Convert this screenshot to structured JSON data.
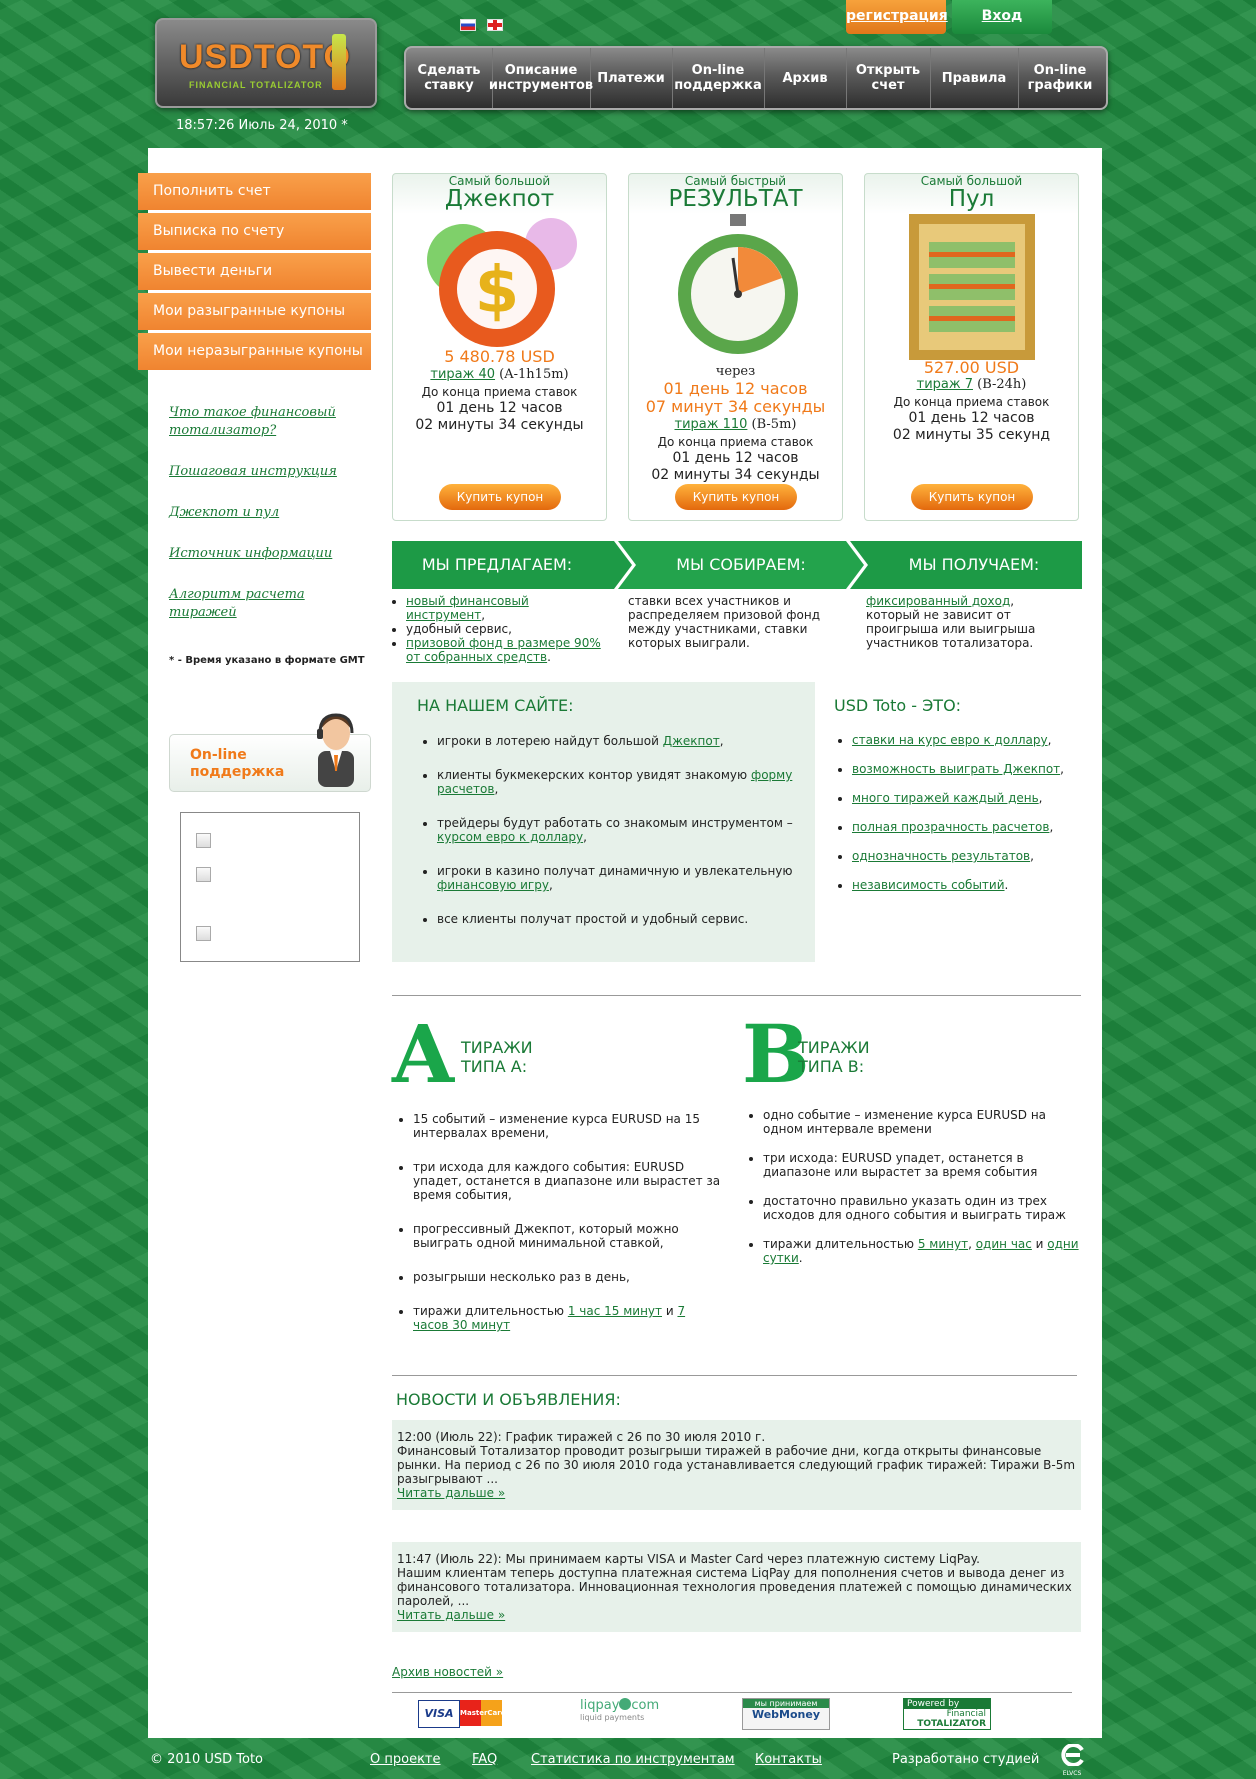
{
  "header": {
    "logo_main": "USDTOTO",
    "logo_sub": "FINANCIAL TOTALIZATOR",
    "clock": "18:57:26 Июль 24, 2010 *",
    "register": "регистрация",
    "login": "Вход",
    "nav": [
      {
        "label": "Сделать\nставку"
      },
      {
        "label": "Описание\nинструментов"
      },
      {
        "label": "Платежи"
      },
      {
        "label": "On-line\nподдержка"
      },
      {
        "label": "Архив"
      },
      {
        "label": "Открыть\nсчет"
      },
      {
        "label": "Правила"
      },
      {
        "label": "On-line\nграфики"
      }
    ]
  },
  "sidebar": {
    "menu": [
      "Пополнить счет",
      "Выписка по счету",
      "Вывести деньги",
      "Мои разыгранные купоны",
      "Мои неразыгранные купоны"
    ],
    "links": [
      "Что такое финансовый тотализатор?",
      "Пошаговая инструкция",
      "Джекпот и пул",
      "Источник информации",
      "Алгоритм расчета тиражей"
    ],
    "gmt_note": "* - Время указано в формате GMT",
    "support": "On-line\nподдержка"
  },
  "promos": [
    {
      "sub": "Самый большой",
      "title": "Джекпот",
      "amount": "5 480.78 USD",
      "draw_link": "тираж 40",
      "draw_code": "(A-1h15m)",
      "until": "До конца приема ставок",
      "days": "01 день 12 часов",
      "minutes": "02 минуты 34 секунды",
      "buy": "Купить купон"
    },
    {
      "sub": "Самый быстрый",
      "title": "РЕЗУЛЬТАТ",
      "through": "через",
      "days_o": "01 день 12 часов",
      "min_o": "07 минут 34 секунды",
      "draw_link": "тираж 110",
      "draw_code": "(B-5m)",
      "until": "До конца приема ставок",
      "days": "01 день 12 часов",
      "minutes": "02 минуты 34 секунды",
      "buy": "Купить купон"
    },
    {
      "sub": "Самый большой",
      "title": "Пул",
      "amount": "527.00 USD",
      "draw_link": "тираж 7",
      "draw_code": "(B-24h)",
      "until": "До конца приема ставок",
      "days": "01 день 12 часов",
      "minutes": "02 минуты 35 секунд",
      "buy": "Купить купон"
    }
  ],
  "strip": {
    "a": "МЫ ПРЕДЛАГАЕМ:",
    "b": "МЫ СОБИРАЕМ:",
    "c": "МЫ ПОЛУЧАЕМ:"
  },
  "offer": {
    "l1_link": "новый финансовый инструмент",
    "l1_rest": ",",
    "l2": "удобный сервис,",
    "l3_link": "призовой фонд в размере 90% от собранных средств",
    "l3_rest": ".",
    "collect": "ставки всех участников и распределяем призовой фонд между участниками, ставки которых выиграли.",
    "get_link": "фиксированный доход",
    "get_rest": ", который не зависит от проигрыша или выигрыша участников тотализатора."
  },
  "site": {
    "title": "НА НАШЕМ САЙТЕ:",
    "i1": "игроки в лотерею найдут большой ",
    "i1_link": "Джекпот",
    "i1_end": ",",
    "i2": "клиенты букмекерских контор увидят знакомую ",
    "i2_link": "форму расчетов",
    "i2_end": ",",
    "i3": "трейдеры будут работать со знакомым инструментом – ",
    "i3_link": "курсом евро к доллару",
    "i3_end": ",",
    "i4": "игроки в казино получат динамичную и увлекательную ",
    "i4_link": "финансовую игру",
    "i4_end": ",",
    "i5": "все клиенты получат простой и удобный сервис."
  },
  "toto": {
    "title": "USD Toto - ЭТО:",
    "items": [
      "ставки на курс евро к доллару",
      "возможность выиграть Джекпот",
      "много тиражей каждый день",
      "полная прозрачность расчетов",
      "однозначность результатов",
      "независимость событий"
    ],
    "ends": [
      ",",
      ",",
      ",",
      ",",
      ",",
      "."
    ]
  },
  "typeA": {
    "letter": "A",
    "h1": "ТИРАЖИ",
    "h2": "ТИПА А:",
    "i1": "15 событий – изменение курса EURUSD на 15 интервалах времени,",
    "i2": "три исхода для каждого события: EURUSD упадет, останется в диапазоне или вырастет за время события,",
    "i3": "прогрессивный Джекпот, который можно выиграть одной минимальной ставкой,",
    "i4": "розыгрыши несколько раз в день,",
    "i5": "тиражи длительностью ",
    "i5_l1": "1 час 15 минут",
    "i5_and": " и ",
    "i5_l2": "7 часов 30 минут"
  },
  "typeB": {
    "letter": "B",
    "h1": "ТИРАЖИ",
    "h2": "ТИПА B:",
    "i1": "одно событие – изменение курса EURUSD на одном интервале времени",
    "i2": "три исхода: EURUSD упадет, останется в диапазоне или вырастет за время события",
    "i3": "достаточно правильно указать один из трех исходов для одного события и выиграть тираж",
    "i4": "тиражи длительностью ",
    "i4_l1": "5 минут",
    "i4_c": ", ",
    "i4_l2": "один час",
    "i4_and": " и ",
    "i4_l3": "одни сутки",
    "i4_end": "."
  },
  "news": {
    "title": "НОВОСТИ И ОБЪЯВЛЕНИЯ:",
    "items": [
      {
        "head": "12:00 (Июль 22): График тиражей с 26 по 30 июля 2010 г.",
        "body": "Финансовый Тотализатор проводит розыгрыши тиражей в рабочие дни, когда открыты финансовые рынки. На период с 26 по 30 июля 2010 года устанавливается следующий график тиражей: Тиражи B-5m разыгрывают ...",
        "more": "Читать дальше »"
      },
      {
        "head": "11:47 (Июль 22): Мы принимаем карты VISA и Master Card через платежную систему LiqPay.",
        "body": "Нашим клиентам теперь доступна платежная система LiqPay для пополнения счетов и вывода денег из финансового тотализатора. Инновационная технология проведения платежей с помощью динамических паролей, ...",
        "more": "Читать дальше »"
      }
    ],
    "archive": "Архив новостей »"
  },
  "payments": {
    "visa": "VISA",
    "mc": "MasterCard",
    "liqpay": "liqpay",
    "liqpay_com": "com",
    "liqpay_sub": "liquid payments",
    "webm_top": "мы принимаем",
    "webm": "WebMoney",
    "ft_top": "Powered by",
    "ft1": "Financial",
    "ft2": "TOTALIZATOR"
  },
  "footer": {
    "copy": "© 2010 USD Toto",
    "about": "О проекте",
    "faq": "FAQ",
    "stats": "Статистика по инструментам",
    "contacts": "Контакты",
    "dev": "Разработано студией",
    "dev_logo": "ELVCS"
  }
}
